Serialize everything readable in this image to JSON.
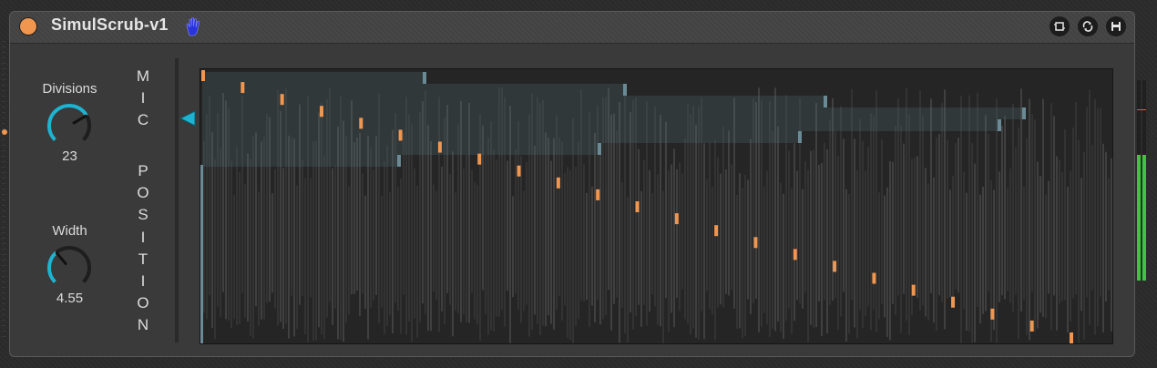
{
  "device": {
    "title": "SimulScrub-v1",
    "accent_color": "#f0964f",
    "knob_color": "#1fb3d2",
    "hand_icon": "hand-icon",
    "header_buttons": [
      {
        "name": "map-button",
        "icon": "map-icon"
      },
      {
        "name": "freeze-button",
        "icon": "refresh-icon"
      },
      {
        "name": "save-preset-button",
        "icon": "save-icon"
      }
    ]
  },
  "controls": {
    "divisions": {
      "label": "Divisions",
      "value": "23",
      "level": 0.72
    },
    "width": {
      "label": "Width",
      "value": "4.55",
      "level": 0.35
    }
  },
  "mic_position": {
    "label_line1": [
      "M",
      "I",
      "C"
    ],
    "label_line2": [
      "P",
      "O",
      "S",
      "I",
      "T",
      "I",
      "O",
      "N"
    ],
    "level": 0.85
  },
  "display": {
    "divisions": 23,
    "waveform_color": "#3f3f3f",
    "region_color": "#4f6a72",
    "marker_color": "#f0964f"
  },
  "meter": {
    "left_level": 0.63,
    "right_level": 0.63,
    "color": "#3ec43e",
    "peak_color": "#e05a2a"
  }
}
